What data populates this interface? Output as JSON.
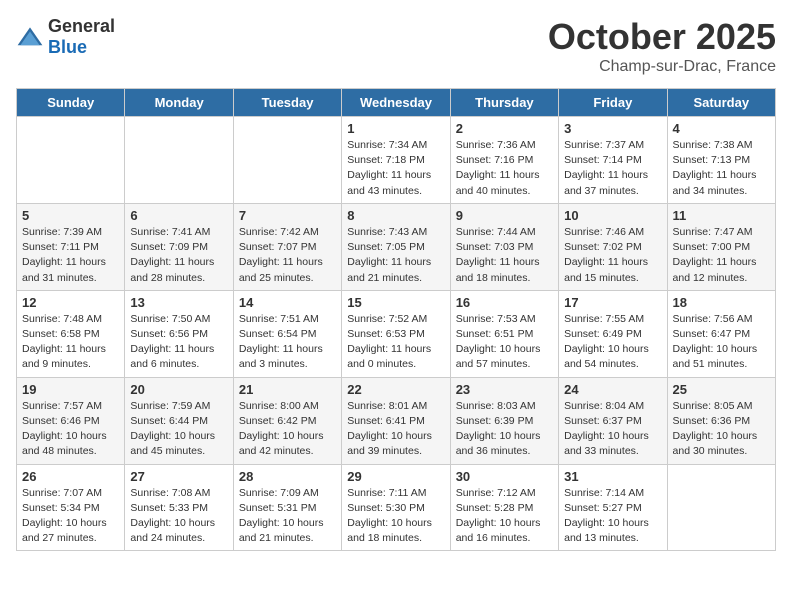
{
  "header": {
    "logo_general": "General",
    "logo_blue": "Blue",
    "month": "October 2025",
    "location": "Champ-sur-Drac, France"
  },
  "weekdays": [
    "Sunday",
    "Monday",
    "Tuesday",
    "Wednesday",
    "Thursday",
    "Friday",
    "Saturday"
  ],
  "weeks": [
    [
      {
        "day": "",
        "info": ""
      },
      {
        "day": "",
        "info": ""
      },
      {
        "day": "",
        "info": ""
      },
      {
        "day": "1",
        "info": "Sunrise: 7:34 AM\nSunset: 7:18 PM\nDaylight: 11 hours\nand 43 minutes."
      },
      {
        "day": "2",
        "info": "Sunrise: 7:36 AM\nSunset: 7:16 PM\nDaylight: 11 hours\nand 40 minutes."
      },
      {
        "day": "3",
        "info": "Sunrise: 7:37 AM\nSunset: 7:14 PM\nDaylight: 11 hours\nand 37 minutes."
      },
      {
        "day": "4",
        "info": "Sunrise: 7:38 AM\nSunset: 7:13 PM\nDaylight: 11 hours\nand 34 minutes."
      }
    ],
    [
      {
        "day": "5",
        "info": "Sunrise: 7:39 AM\nSunset: 7:11 PM\nDaylight: 11 hours\nand 31 minutes."
      },
      {
        "day": "6",
        "info": "Sunrise: 7:41 AM\nSunset: 7:09 PM\nDaylight: 11 hours\nand 28 minutes."
      },
      {
        "day": "7",
        "info": "Sunrise: 7:42 AM\nSunset: 7:07 PM\nDaylight: 11 hours\nand 25 minutes."
      },
      {
        "day": "8",
        "info": "Sunrise: 7:43 AM\nSunset: 7:05 PM\nDaylight: 11 hours\nand 21 minutes."
      },
      {
        "day": "9",
        "info": "Sunrise: 7:44 AM\nSunset: 7:03 PM\nDaylight: 11 hours\nand 18 minutes."
      },
      {
        "day": "10",
        "info": "Sunrise: 7:46 AM\nSunset: 7:02 PM\nDaylight: 11 hours\nand 15 minutes."
      },
      {
        "day": "11",
        "info": "Sunrise: 7:47 AM\nSunset: 7:00 PM\nDaylight: 11 hours\nand 12 minutes."
      }
    ],
    [
      {
        "day": "12",
        "info": "Sunrise: 7:48 AM\nSunset: 6:58 PM\nDaylight: 11 hours\nand 9 minutes."
      },
      {
        "day": "13",
        "info": "Sunrise: 7:50 AM\nSunset: 6:56 PM\nDaylight: 11 hours\nand 6 minutes."
      },
      {
        "day": "14",
        "info": "Sunrise: 7:51 AM\nSunset: 6:54 PM\nDaylight: 11 hours\nand 3 minutes."
      },
      {
        "day": "15",
        "info": "Sunrise: 7:52 AM\nSunset: 6:53 PM\nDaylight: 11 hours\nand 0 minutes."
      },
      {
        "day": "16",
        "info": "Sunrise: 7:53 AM\nSunset: 6:51 PM\nDaylight: 10 hours\nand 57 minutes."
      },
      {
        "day": "17",
        "info": "Sunrise: 7:55 AM\nSunset: 6:49 PM\nDaylight: 10 hours\nand 54 minutes."
      },
      {
        "day": "18",
        "info": "Sunrise: 7:56 AM\nSunset: 6:47 PM\nDaylight: 10 hours\nand 51 minutes."
      }
    ],
    [
      {
        "day": "19",
        "info": "Sunrise: 7:57 AM\nSunset: 6:46 PM\nDaylight: 10 hours\nand 48 minutes."
      },
      {
        "day": "20",
        "info": "Sunrise: 7:59 AM\nSunset: 6:44 PM\nDaylight: 10 hours\nand 45 minutes."
      },
      {
        "day": "21",
        "info": "Sunrise: 8:00 AM\nSunset: 6:42 PM\nDaylight: 10 hours\nand 42 minutes."
      },
      {
        "day": "22",
        "info": "Sunrise: 8:01 AM\nSunset: 6:41 PM\nDaylight: 10 hours\nand 39 minutes."
      },
      {
        "day": "23",
        "info": "Sunrise: 8:03 AM\nSunset: 6:39 PM\nDaylight: 10 hours\nand 36 minutes."
      },
      {
        "day": "24",
        "info": "Sunrise: 8:04 AM\nSunset: 6:37 PM\nDaylight: 10 hours\nand 33 minutes."
      },
      {
        "day": "25",
        "info": "Sunrise: 8:05 AM\nSunset: 6:36 PM\nDaylight: 10 hours\nand 30 minutes."
      }
    ],
    [
      {
        "day": "26",
        "info": "Sunrise: 7:07 AM\nSunset: 5:34 PM\nDaylight: 10 hours\nand 27 minutes."
      },
      {
        "day": "27",
        "info": "Sunrise: 7:08 AM\nSunset: 5:33 PM\nDaylight: 10 hours\nand 24 minutes."
      },
      {
        "day": "28",
        "info": "Sunrise: 7:09 AM\nSunset: 5:31 PM\nDaylight: 10 hours\nand 21 minutes."
      },
      {
        "day": "29",
        "info": "Sunrise: 7:11 AM\nSunset: 5:30 PM\nDaylight: 10 hours\nand 18 minutes."
      },
      {
        "day": "30",
        "info": "Sunrise: 7:12 AM\nSunset: 5:28 PM\nDaylight: 10 hours\nand 16 minutes."
      },
      {
        "day": "31",
        "info": "Sunrise: 7:14 AM\nSunset: 5:27 PM\nDaylight: 10 hours\nand 13 minutes."
      },
      {
        "day": "",
        "info": ""
      }
    ]
  ]
}
